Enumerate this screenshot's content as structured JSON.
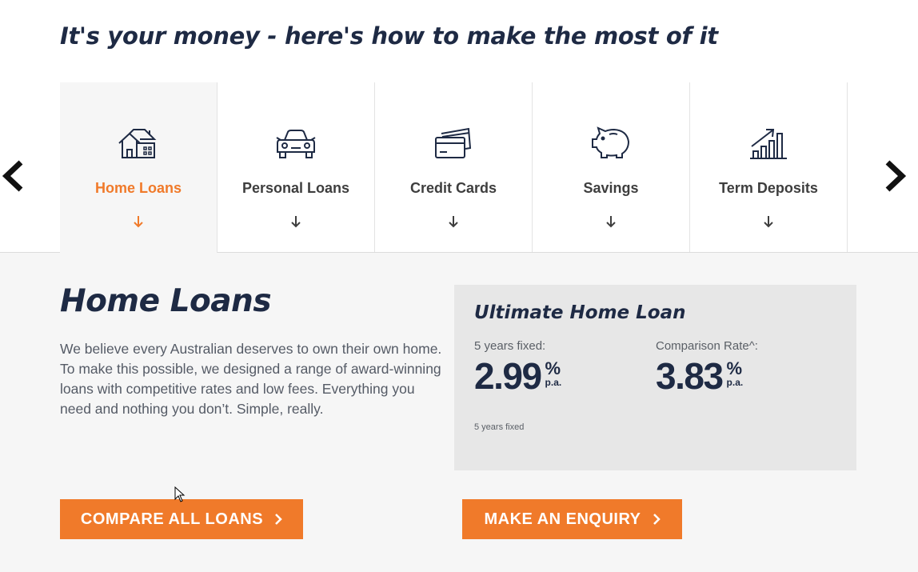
{
  "heading": "It's your money - here's how to make the most of it",
  "tabs": [
    {
      "label": "Home Loans",
      "icon": "house-icon",
      "active": true
    },
    {
      "label": "Personal Loans",
      "icon": "car-icon",
      "active": false
    },
    {
      "label": "Credit Cards",
      "icon": "credit-cards-icon",
      "active": false
    },
    {
      "label": "Savings",
      "icon": "piggy-bank-icon",
      "active": false
    },
    {
      "label": "Term Deposits",
      "icon": "growth-chart-icon",
      "active": false
    }
  ],
  "panel": {
    "title": "Home Loans",
    "description": "We believe every Australian deserves to own their own home. To make this possible, we designed a range of award-winning loans with competitive rates and low fees. Everything you need and nothing you don’t. Simple, really.",
    "card": {
      "title": "Ultimate Home Loan",
      "rates": [
        {
          "label": "5 years fixed:",
          "value": "2.99",
          "unit": "%",
          "period": "p.a."
        },
        {
          "label": "Comparison Rate^:",
          "value": "3.83",
          "unit": "%",
          "period": "p.a."
        }
      ],
      "footnote": "5 years fixed"
    },
    "buttons": {
      "compare": "COMPARE ALL LOANS",
      "enquiry": "MAKE AN ENQUIRY"
    }
  },
  "colors": {
    "accent": "#f07a2a",
    "navy": "#1e2a44",
    "panel_bg": "#f6f6f6",
    "card_bg": "#e7e7e7"
  }
}
